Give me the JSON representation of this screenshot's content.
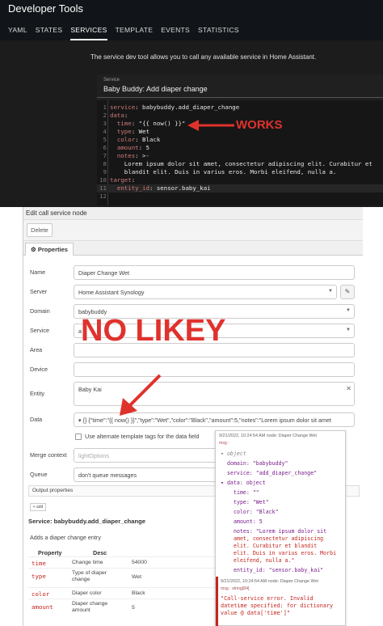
{
  "ha": {
    "title": "Developer Tools",
    "tabs": [
      "YAML",
      "STATES",
      "SERVICES",
      "TEMPLATE",
      "EVENTS",
      "STATISTICS"
    ],
    "active_tab": "SERVICES",
    "description": "The service dev tool allows you to call any available service in Home Assistant.",
    "service_label": "Service",
    "service_value": "Baby Buddy: Add diaper change",
    "code_lines": [
      "service: babybuddy.add_diaper_change",
      "data:",
      "  time: \"{{ now() }}\"",
      "  type: Wet",
      "  color: Black",
      "  amount: 5",
      "  notes: >-",
      "    Lorem ipsum dolor sit amet, consectetur adipiscing elit. Curabitur et",
      "    blandit elit. Duis in varius eros. Morbi eleifend, nulla a.",
      "target:",
      "  entity_id: sensor.baby_kai",
      ""
    ],
    "annotation": "WORKS"
  },
  "nr": {
    "title": "Edit call service node",
    "delete_label": "Delete",
    "properties_tab": "Properties",
    "fields": {
      "name": {
        "label": "Name",
        "value": "Diaper Change Wet"
      },
      "server": {
        "label": "Server",
        "value": "Home Assistant Synology"
      },
      "domain": {
        "label": "Domain",
        "value": "babybuddy"
      },
      "service": {
        "label": "Service",
        "value": "a"
      },
      "area": {
        "label": "Area",
        "value": ""
      },
      "device": {
        "label": "Device",
        "value": ""
      },
      "entity": {
        "label": "Entity",
        "value": "Baby Kai"
      },
      "data": {
        "label": "Data",
        "type_icon": "{}",
        "value": "{\"time\":\"{{ now() }}\",\"type\":\"Wet\",\"color\":\"Black\",\"amount\":5,\"notes\":\"Lorem ipsum dolor sit amet"
      },
      "alt_tags": "Use alternate template tags for the data field",
      "merge": {
        "label": "Merge context",
        "placeholder": "lightOptions"
      },
      "queue": {
        "label": "Queue",
        "value": "don't queue messages"
      }
    },
    "output_properties": "Output properties",
    "add_label": "+ add",
    "service_heading": "Service: babybuddy.add_diaper_change",
    "service_desc": "Adds a diaper change entry",
    "table_headers": [
      "Property",
      "Desc"
    ],
    "table_rows": [
      {
        "name": "time",
        "desc": "Change time",
        "value": "54000"
      },
      {
        "name": "type",
        "desc": "Type of diaper change",
        "value": "Wet"
      },
      {
        "name": "color",
        "desc": "Diaper color",
        "value": "Black"
      },
      {
        "name": "amount",
        "desc": "Diaper change amount",
        "value": "5"
      }
    ],
    "annotation": "NO LIKEY"
  },
  "debug": {
    "msg1_meta": "9/21/2022, 10:24:54 AM   node: Diaper Change Wet",
    "msg1_type": "msg :",
    "lines": [
      "▾ object",
      "domain: \"babybuddy\"",
      "service: \"add_diaper_change\"",
      "▾ data: object",
      "time: \"\"",
      "type: \"Wet\"",
      "color: \"Black\"",
      "amount: 5",
      "notes: \"Lorem ipsum dolor sit",
      "amet, consectetur adipiscing",
      "elit. Curabitur et blandit",
      "elit. Duis in varius eros. Morbi",
      "eleifend, nulla a.\"",
      "entity_id: \"sensor.baby_kai\""
    ],
    "msg2_meta": "9/21/2022, 10:24:54 AM   node: Diaper Change Wet",
    "msg2_type": "msg : string[84]",
    "error_text": "\"Call-service error. Invalid datetime specified:  for dictionary value @ data['time']\""
  },
  "colors": {
    "annotation_red": "#e0322d",
    "ha_bg": "#1c1c1c",
    "error_red": "#c3251f"
  }
}
